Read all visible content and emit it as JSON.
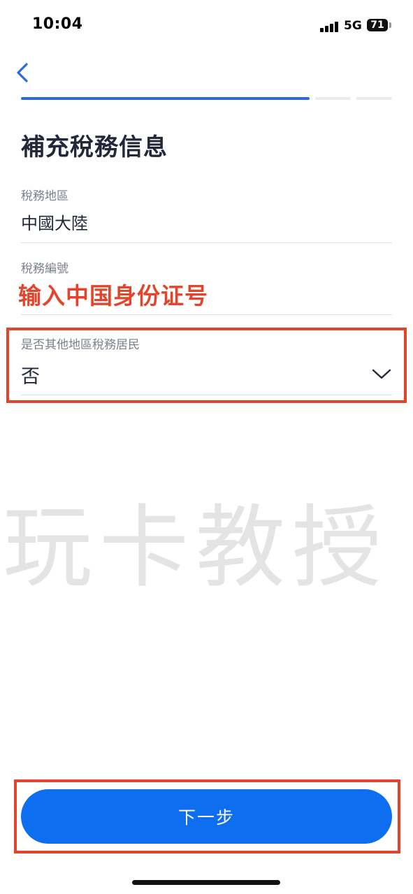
{
  "status_bar": {
    "time": "10:04",
    "network": "5G",
    "battery": "71"
  },
  "header": {
    "back_icon": "chevron-left-icon",
    "progress_steps_total": 3,
    "progress_step_current": 1
  },
  "page": {
    "title": "補充稅務信息"
  },
  "form": {
    "tax_region": {
      "label": "稅務地區",
      "value": "中國大陸"
    },
    "tax_number": {
      "label": "稅務編號",
      "value": ""
    },
    "other_resident": {
      "label": "是否其他地區稅務居民",
      "value": "否",
      "icon": "chevron-down-icon"
    }
  },
  "annotation": {
    "note": "输入中国身份证号",
    "color": "#e2452b"
  },
  "watermark": "玩卡教授",
  "footer": {
    "next_label": "下一步",
    "button_color": "#0d6ef0"
  }
}
